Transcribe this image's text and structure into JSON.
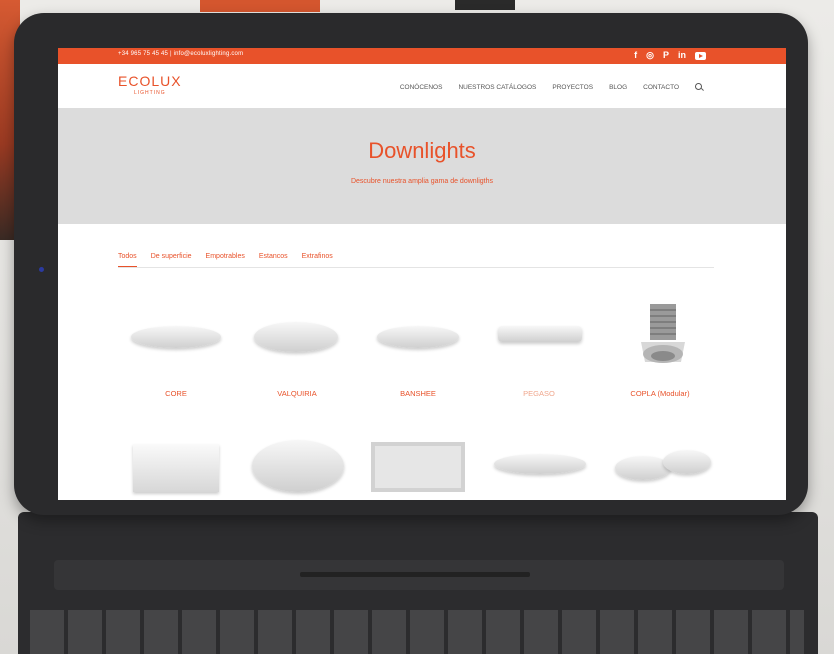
{
  "topbar": {
    "contact": "+34 965 75 45 45 | info@ecoluxlighting.com",
    "socials": [
      "facebook-icon",
      "instagram-icon",
      "pinterest-icon",
      "linkedin-icon",
      "youtube-icon"
    ],
    "social_glyphs": {
      "facebook": "f",
      "instagram": "◎",
      "pinterest": "P",
      "linkedin": "in"
    }
  },
  "header": {
    "logo": "ECOLUX",
    "logo_sub": "LIGHTING",
    "nav": [
      "CONÓCENOS",
      "NUESTROS CATÁLOGOS",
      "PROYECTOS",
      "BLOG",
      "CONTACTO"
    ]
  },
  "hero": {
    "title": "Downlights",
    "subtitle": "Descubre nuestra amplia gama de downligths"
  },
  "filters": [
    "Todos",
    "De superficie",
    "Empotrables",
    "Estancos",
    "Extrafinos"
  ],
  "products": [
    "CORE",
    "VALQUIRIA",
    "BANSHEE",
    "PEGASO",
    "COPLA (Modular)"
  ],
  "colors": {
    "brand": "#e8522a",
    "hero_bg": "#dcdcdc"
  }
}
